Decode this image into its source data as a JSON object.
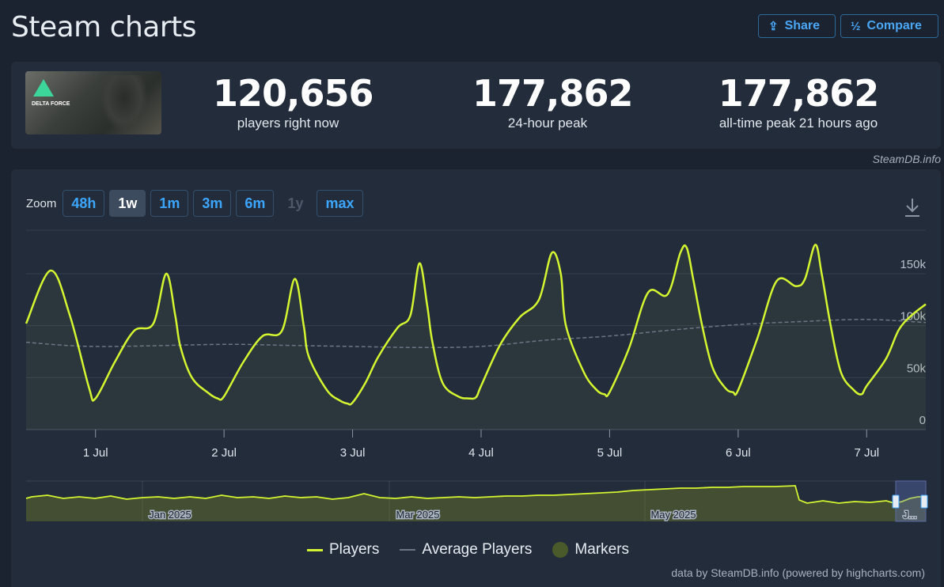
{
  "header": {
    "title": "Steam charts",
    "share_label": "Share",
    "compare_label": "Compare"
  },
  "game": {
    "thumb_logo_text": "DELTA FORCE"
  },
  "stats": [
    {
      "value": "120,656",
      "label": "players right now"
    },
    {
      "value": "177,862",
      "label": "24-hour peak"
    },
    {
      "value": "177,862",
      "label": "all-time peak 21 hours ago"
    }
  ],
  "credit_top": "SteamDB.info",
  "zoom": {
    "label": "Zoom",
    "options": [
      "48h",
      "1w",
      "1m",
      "3m",
      "6m",
      "1y",
      "max"
    ],
    "active": "1w",
    "disabled": [
      "1y"
    ]
  },
  "navigator": {
    "labels": [
      "Jan 2025",
      "Mar 2025",
      "May 2025",
      "J..."
    ]
  },
  "legend": {
    "players": "Players",
    "average": "Average Players",
    "markers": "Markers"
  },
  "credit_bottom": "data by SteamDB.info (powered by highcharts.com)",
  "colors": {
    "players": "#d4f52f",
    "average": "#6b7584",
    "accent": "#3ca6ff"
  },
  "chart_data": {
    "type": "line",
    "x_tick_labels": [
      "1 Jul",
      "2 Jul",
      "3 Jul",
      "4 Jul",
      "5 Jul",
      "6 Jul",
      "7 Jul"
    ],
    "y_tick_labels": [
      "0",
      "50k",
      "100k",
      "150k"
    ],
    "ylim": [
      0,
      185000
    ],
    "x_range_days": [
      -0.54,
      6.46
    ],
    "grid": true,
    "legend_position": "bottom",
    "series": [
      {
        "name": "Players",
        "x": [
          -0.54,
          -0.35,
          -0.2,
          -0.05,
          0.0,
          0.15,
          0.3,
          0.45,
          0.55,
          0.62,
          0.66,
          0.75,
          0.88,
          0.95,
          1.0,
          1.15,
          1.3,
          1.45,
          1.55,
          1.62,
          1.66,
          1.8,
          1.9,
          1.96,
          2.0,
          2.1,
          2.2,
          2.35,
          2.45,
          2.52,
          2.58,
          2.62,
          2.7,
          2.82,
          2.9,
          2.96,
          3.0,
          3.15,
          3.3,
          3.45,
          3.55,
          3.62,
          3.66,
          3.8,
          3.9,
          3.96,
          4.0,
          4.15,
          4.3,
          4.45,
          4.55,
          4.6,
          4.65,
          4.72,
          4.8,
          4.9,
          4.96,
          5.0,
          5.15,
          5.3,
          5.45,
          5.52,
          5.6,
          5.65,
          5.72,
          5.8,
          5.9,
          5.96,
          6.0,
          6.15,
          6.25,
          6.35,
          6.46
        ],
        "y": [
          102000,
          153000,
          110000,
          40000,
          30000,
          65000,
          95000,
          102000,
          150000,
          110000,
          80000,
          50000,
          35000,
          30000,
          32000,
          65000,
          90000,
          95000,
          145000,
          100000,
          70000,
          38000,
          28000,
          25000,
          26000,
          45000,
          70000,
          98000,
          110000,
          160000,
          120000,
          85000,
          45000,
          32000,
          30000,
          31000,
          42000,
          82000,
          108000,
          125000,
          170000,
          150000,
          100000,
          55000,
          38000,
          34000,
          36000,
          78000,
          132000,
          130000,
          170000,
          175000,
          145000,
          100000,
          60000,
          40000,
          36000,
          38000,
          88000,
          143000,
          138000,
          145000,
          177862,
          150000,
          100000,
          55000,
          38000,
          34000,
          42000,
          68000,
          96000,
          110000,
          120656
        ]
      },
      {
        "name": "Average Players",
        "x": [
          -0.54,
          0.0,
          1.0,
          1.5,
          2.0,
          2.5,
          3.0,
          3.5,
          4.0,
          4.5,
          5.0,
          5.5,
          6.0,
          6.46
        ],
        "y": [
          84000,
          80000,
          82000,
          81000,
          80000,
          79000,
          80000,
          86000,
          90000,
          96000,
          101000,
          104000,
          106000,
          103000
        ]
      }
    ]
  }
}
